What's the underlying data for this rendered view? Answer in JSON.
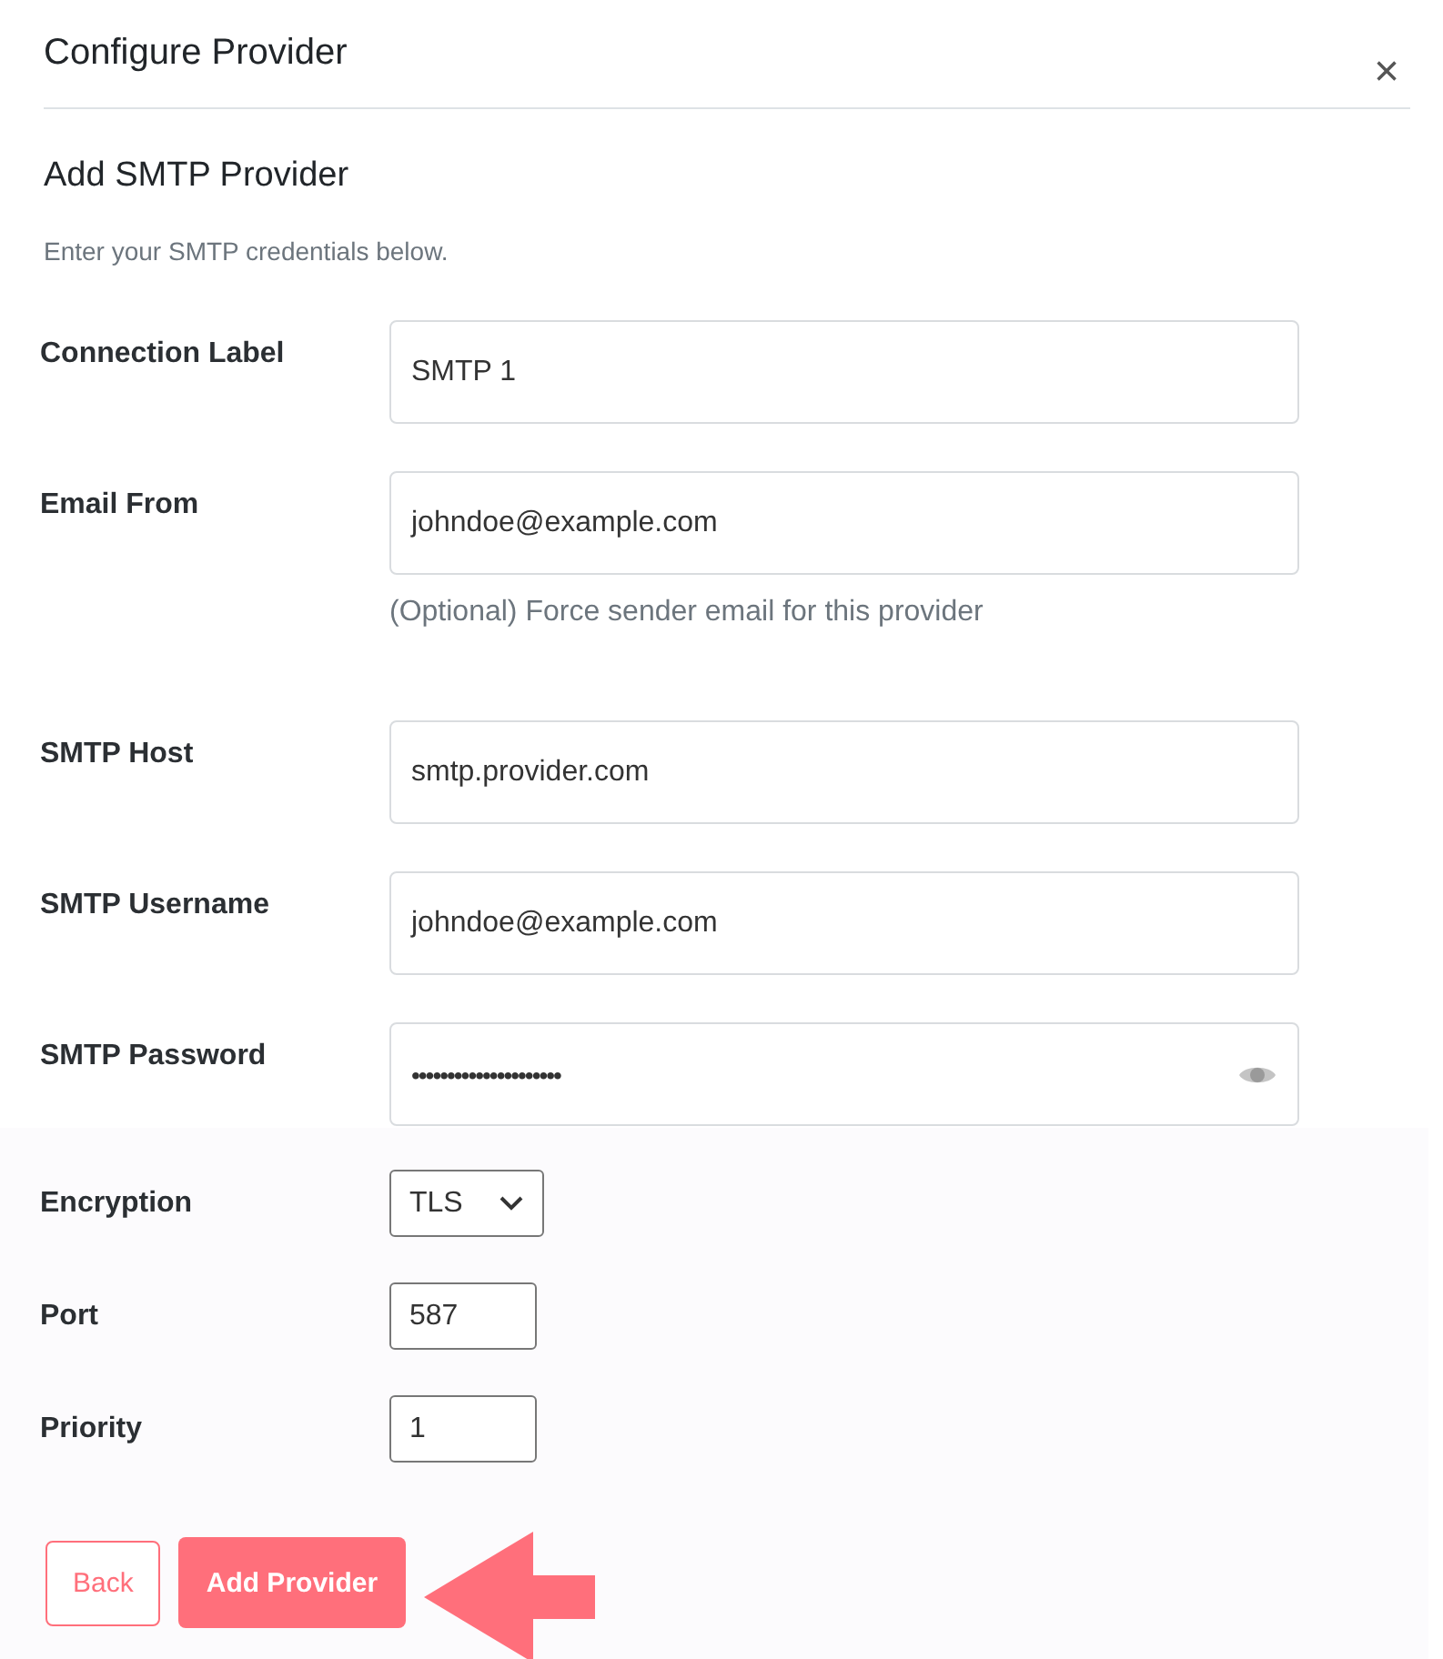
{
  "dialog": {
    "title": "Configure Provider",
    "close": "×"
  },
  "section": {
    "heading": "Add SMTP Provider",
    "description": "Enter your SMTP credentials below."
  },
  "fields": [
    {
      "kind": "text",
      "label": "Connection Label",
      "value": "SMTP 1"
    },
    {
      "kind": "text",
      "label": "Email From",
      "value": "johndoe@example.com",
      "help": "(Optional) Force sender email for this provider"
    },
    {
      "kind": "text",
      "label": "SMTP Host",
      "value": "smtp.provider.com"
    },
    {
      "kind": "text",
      "label": "SMTP Username",
      "value": "johndoe@example.com"
    },
    {
      "kind": "password",
      "label": "SMTP Password",
      "value": "•••••••••••••••••••••"
    }
  ],
  "options": [
    {
      "kind": "select",
      "label": "Encryption",
      "value": "TLS"
    },
    {
      "kind": "number",
      "label": "Port",
      "value": "587"
    },
    {
      "kind": "number",
      "label": "Priority",
      "value": "1"
    }
  ],
  "buttons": [
    {
      "kind": "secondary",
      "label": "Back"
    },
    {
      "kind": "primary",
      "label": "Add Provider"
    }
  ]
}
